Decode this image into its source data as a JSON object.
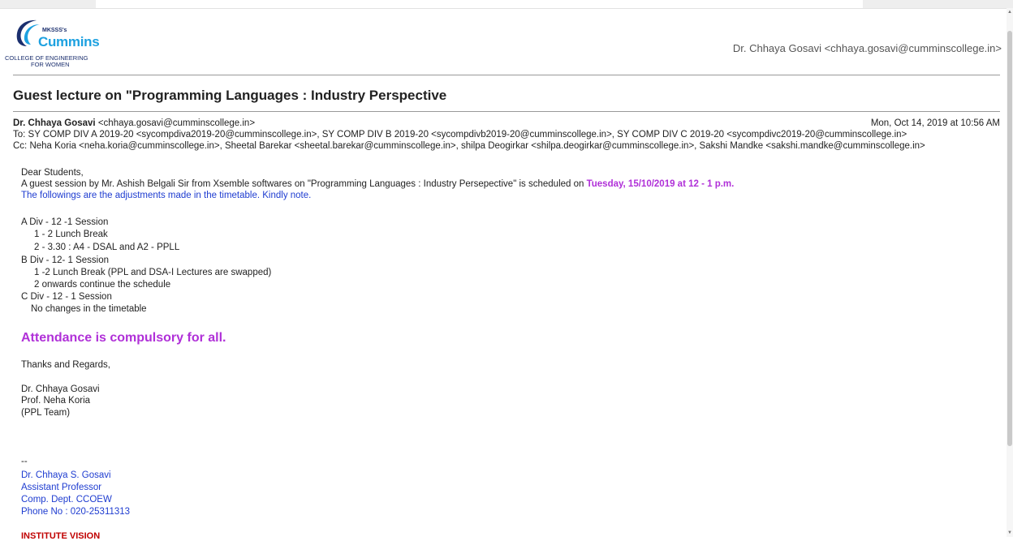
{
  "logo": {
    "org_prefix": "MKSSS's",
    "org_name": "Cummins",
    "line1": "COLLEGE OF ENGINEERING",
    "line2": "FOR WOMEN"
  },
  "header": {
    "sender": "Dr. Chhaya Gosavi <chhaya.gosavi@cumminscollege.in>"
  },
  "subject": "Guest lecture on \"Programming Languages : Industry Perspective",
  "message": {
    "from_name": "Dr. Chhaya Gosavi",
    "from_email": "<chhaya.gosavi@cumminscollege.in>",
    "date": "Mon, Oct 14, 2019 at 10:56 AM",
    "to": "To: SY COMP DIV A 2019-20 <sycompdiva2019-20@cumminscollege.in>, SY COMP DIV B 2019-20 <sycompdivb2019-20@cumminscollege.in>, SY COMP DIV C 2019-20 <sycompdivc2019-20@cumminscollege.in>",
    "cc": "Cc: Neha Koria <neha.koria@cumminscollege.in>, Sheetal Barekar <sheetal.barekar@cumminscollege.in>, shilpa Deogirkar <shilpa.deogirkar@cumminscollege.in>, Sakshi Mandke <sakshi.mandke@cumminscollege.in>"
  },
  "body": {
    "greeting": "Dear Students,",
    "intro": "A  guest session by Mr. Ashish Belgali Sir from Xsemble softwares on \"Programming Languages : Industry Persepective\"  is scheduled on ",
    "intro_highlight": "Tuesday, 15/10/2019 at 12 - 1 p.m.",
    "adjustments": "The followings are the adjustments made in the timetable. Kindly note.",
    "schedule": [
      "A Div - 12 -1 Session",
      "1 - 2 Lunch Break",
      "2 - 3.30 :  A4 - DSAL and A2 - PPLL",
      "B Div - 12- 1 Session",
      "1 -2 Lunch Break   (PPL and DSA-I Lectures are swapped)",
      "2 onwards continue the schedule",
      "C Div - 12 - 1 Session",
      "No changes in the timetable"
    ],
    "attendance": "Attendance is compulsory for all.",
    "thanks": "Thanks and Regards,",
    "signoff": [
      "Dr. Chhaya Gosavi",
      "Prof.  Neha Koria",
      "(PPL Team)"
    ]
  },
  "signature": {
    "dashes": "--",
    "lines": [
      "Dr.  Chhaya S. Gosavi",
      "Assistant Professor",
      "Comp. Dept. CCOEW",
      "Phone No : 020-25311313"
    ]
  },
  "footer": {
    "vision": "INSTITUTE VISION"
  },
  "colors": {
    "link_blue": "#1e3cd0",
    "highlight_magenta": "#b030d8",
    "vision_red": "#c00000"
  }
}
